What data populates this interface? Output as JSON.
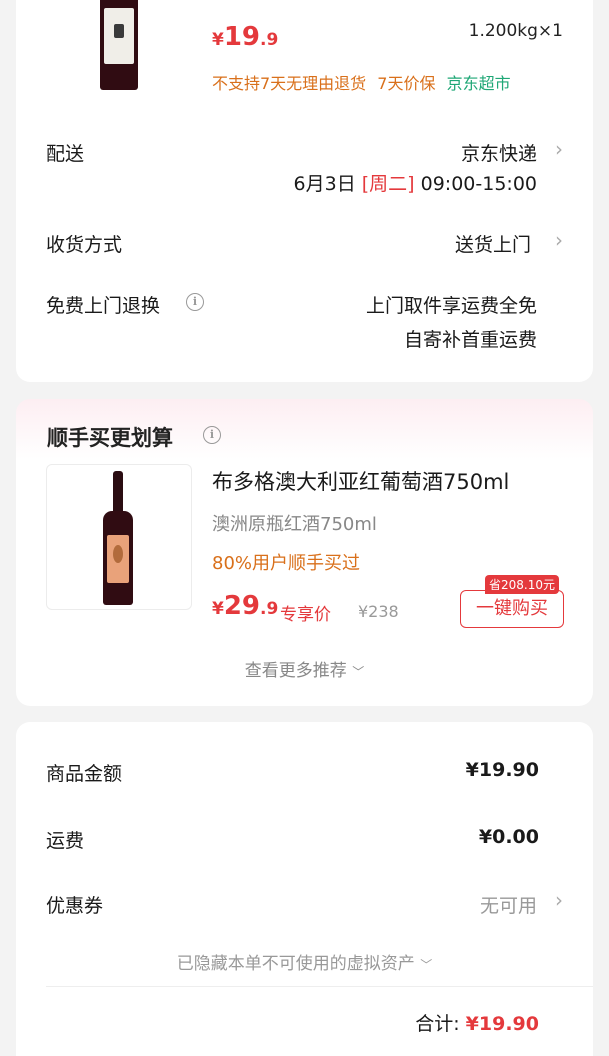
{
  "product": {
    "price_symbol": "¥",
    "price_int": "19",
    "price_dec": ".9",
    "weight_qty": "1.200kg×1",
    "tags": {
      "no_return": "不支持7天无理由退货",
      "price_protect": "7天价保",
      "store": "京东超市"
    }
  },
  "delivery": {
    "label": "配送",
    "carrier": "京东快递",
    "date": "6月3日",
    "weekday": "[周二]",
    "time": "09:00-15:00"
  },
  "receive": {
    "label": "收货方式",
    "value": "送货上门"
  },
  "free_return": {
    "label": "免费上门退换",
    "line1": "上门取件享运费全免",
    "line2": "自寄补首重运费"
  },
  "recommend": {
    "section_title": "顺手买更划算",
    "item": {
      "title": "布多格澳大利亚红葡萄酒750ml",
      "subtitle": "澳洲原瓶红酒750ml",
      "stat": "80%用户顺手买过",
      "price_symbol": "¥",
      "price_int": "29",
      "price_dec": ".9",
      "price_tag": "专享价",
      "original_price": "¥238",
      "save_badge": "省208.10元",
      "buy_button": "一键购买"
    },
    "more": "查看更多推荐"
  },
  "summary": {
    "goods_label": "商品金额",
    "goods_value": "¥19.90",
    "shipping_label": "运费",
    "shipping_value": "¥0.00",
    "coupon_label": "优惠券",
    "coupon_value": "无可用",
    "hidden_assets": "已隐藏本单不可使用的虚拟资产",
    "total_label": "合计:",
    "total_value": "¥19.90"
  },
  "colors": {
    "accent_red": "#e4393c",
    "orange": "#d9701b",
    "green": "#1fa776"
  }
}
